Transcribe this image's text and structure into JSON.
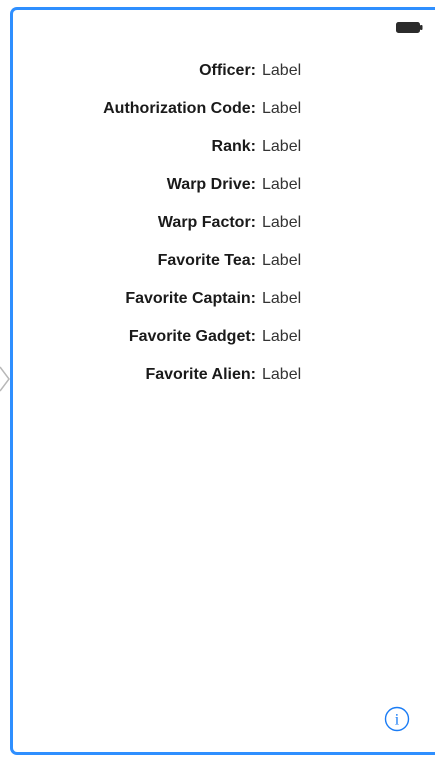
{
  "screen": {
    "fields": [
      {
        "key": "Officer:",
        "value": "Label"
      },
      {
        "key": "Authorization Code:",
        "value": "Label"
      },
      {
        "key": "Rank:",
        "value": "Label"
      },
      {
        "key": "Warp Drive:",
        "value": "Label"
      },
      {
        "key": "Warp Factor:",
        "value": "Label"
      },
      {
        "key": "Favorite Tea:",
        "value": "Label"
      },
      {
        "key": "Favorite Captain:",
        "value": "Label"
      },
      {
        "key": "Favorite Gadget:",
        "value": "Label"
      },
      {
        "key": "Favorite Alien:",
        "value": "Label"
      }
    ]
  },
  "icons": {
    "entry": "entry-point-arrow-icon",
    "battery": "battery-icon",
    "info": "info-icon"
  },
  "colors": {
    "frame_accent": "#2f8fff",
    "info_tint": "#1a7cf5"
  }
}
